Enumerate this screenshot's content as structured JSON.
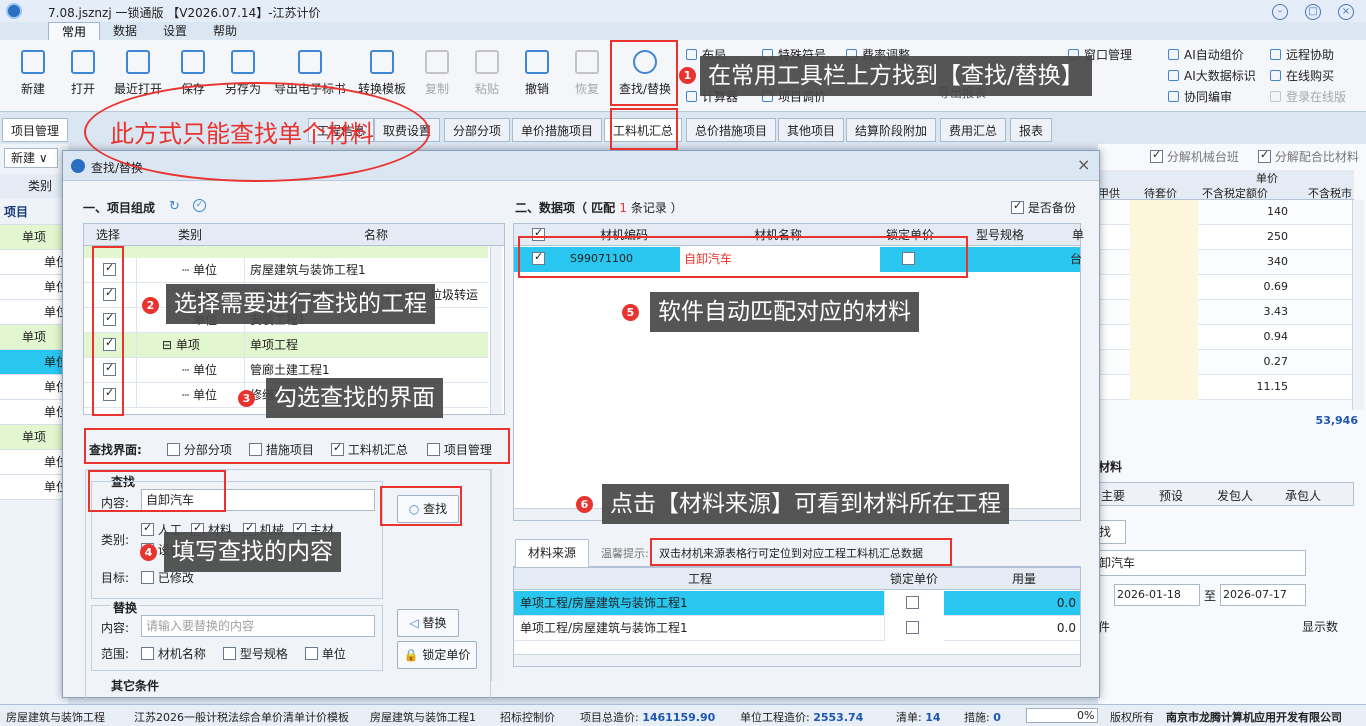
{
  "app": {
    "title": "7.08.jsznzj 一锁通版 【V2026.07.14】-江苏计价",
    "menu_tabs": [
      "常用",
      "数据",
      "设置",
      "帮助"
    ]
  },
  "toolbar": {
    "buttons": [
      "新建",
      "打开",
      "最近打开",
      "保存",
      "另存为",
      "导出电子标书",
      "转换模板",
      "复制",
      "粘贴",
      "撤销",
      "恢复",
      "查找/替换"
    ],
    "small_buttons": [
      "布局",
      "特殊符号",
      "费率调整",
      "计算器",
      "项目调价",
      "窗口管理",
      "AI自动组价",
      "AI大数据标识",
      "协同编审",
      "远程协助",
      "在线购买",
      "登录在线版",
      "导出报表"
    ]
  },
  "tabs": {
    "left": "项目管理",
    "items": [
      "工程信息",
      "取费设置",
      "分部分项",
      "单价措施项目",
      "工料机汇总",
      "总价措施项目",
      "其他项目",
      "结算阶段附加",
      "费用汇总",
      "报表"
    ]
  },
  "leftpane": {
    "new_btn": "新建",
    "col": "类别",
    "rows": [
      "项目",
      "单项",
      "单位",
      "单位",
      "单位",
      "单项",
      "单位",
      "单位",
      "单位",
      "单项",
      "单位",
      "单位"
    ]
  },
  "rightpane": {
    "opt1": "分解机械台班",
    "opt2": "分解配合比材料",
    "headers": [
      "单价",
      "甲供",
      "待套价",
      "不含税定额价",
      "不含税市"
    ],
    "values": [
      "140",
      "250",
      "340",
      "0.69",
      "3.43",
      "0.94",
      "0.27",
      "11.15"
    ],
    "total": "53,946",
    "section": "材料",
    "tabs": [
      "主要",
      "预设",
      "发包人",
      "承包人"
    ],
    "find_btn": "找",
    "search_text": "卸汽车",
    "date_from": "2026-01-18",
    "date_to_label": "至",
    "date_to": "2026-07-17",
    "cond": "件",
    "show_num": "显示数"
  },
  "dialog": {
    "title": "查找/替换",
    "close": "×",
    "left_title": "一、项目组成",
    "tree_headers": [
      "选择",
      "类别",
      "名称"
    ],
    "tree_rows": [
      {
        "cat": "单位",
        "name": "房屋建筑与装饰工程1",
        "level": 2
      },
      {
        "cat": "单位",
        "name": "市政给水、燃气、供热、水处理、垃圾转运",
        "level": 2
      },
      {
        "cat": "单位",
        "name": "安装工程1",
        "level": 2
      },
      {
        "cat": "单项",
        "name": "单项工程",
        "level": 1
      },
      {
        "cat": "单位",
        "name": "管廊土建工程1",
        "level": 2
      },
      {
        "cat": "单位",
        "name": "修缮工程",
        "level": 2
      }
    ],
    "interface_label": "查找界面:",
    "interfaces": [
      "分部分项",
      "措施项目",
      "工料机汇总",
      "项目管理"
    ],
    "find_group": "查找",
    "content_label": "内容:",
    "content_value": "自卸汽车",
    "find_btn": "查找",
    "category_label": "类别:",
    "categories": [
      "人工",
      "材料",
      "机械",
      "主材",
      "设备"
    ],
    "target_label": "目标:",
    "target_opt": "已修改",
    "replace_group": "替换",
    "replace_content_label": "内容:",
    "replace_placeholder": "请输入要替换的内容",
    "replace_btn": "替换",
    "range_label": "范围:",
    "ranges": [
      "材机名称",
      "型号规格",
      "单位"
    ],
    "lock_btn": "锁定单价",
    "other_cond": "其它条件",
    "right_title_pre": "二、数据项（ 匹配 ",
    "right_match_count": "1",
    "right_title_post": " 条记录 ）",
    "backup_label": "是否备份",
    "data_headers": [
      "材机编码",
      "材机名称",
      "锁定单价",
      "型号规格",
      "单"
    ],
    "data_row": {
      "code": "S99071100",
      "name": "自卸汽车",
      "unit": "台"
    },
    "source_tab": "材料来源",
    "hint_label": "温馨提示:",
    "hint_text": "双击材机来源表格行可定位到对应工程工料机汇总数据",
    "source_headers": [
      "工程",
      "锁定单价",
      "用量"
    ],
    "source_rows": [
      {
        "project": "单项工程/房屋建筑与装饰工程1",
        "qty": "0.0"
      },
      {
        "project": "单项工程/房屋建筑与装饰工程1",
        "qty": "0.0"
      }
    ]
  },
  "annotations": {
    "note_top": "此方式只能查找单个材料",
    "c1": "在常用工具栏上方找到【查找/替换】",
    "c2": "选择需要进行查找的工程",
    "c3": "勾选查找的界面",
    "c4": "填写查找的内容",
    "c5": "软件自动匹配对应的材料",
    "c6": "点击【材料来源】可看到材料所在工程",
    "n1": "1",
    "n2": "2",
    "n3": "3",
    "n4": "4",
    "n5": "5",
    "n6": "6"
  },
  "statusbar": {
    "s1": "房屋建筑与装饰工程",
    "s2": "江苏2026一般计税法综合单价清单计价模板",
    "s3": "房屋建筑与装饰工程1",
    "s4": "招标控制价",
    "s5_label": "项目总造价:",
    "s5_val": "1461159.90",
    "s6_label": "单位工程造价:",
    "s6_val": "2553.74",
    "s7_label": "清单:",
    "s7_val": "14",
    "s8_label": "措施:",
    "s8_val": "0",
    "progress": "0%",
    "progress_value": 0,
    "copyright": "版权所有 ",
    "company": "南京市龙腾计算机应用开发有限公司"
  },
  "colors": {
    "accent": "#e8332e",
    "selected_row": "#29c6f0",
    "tree_band": "#e2f6cf"
  }
}
